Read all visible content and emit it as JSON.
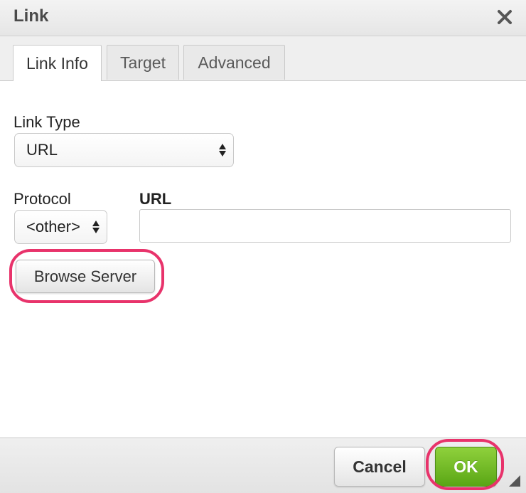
{
  "dialog": {
    "title": "Link",
    "close_icon": "close-icon"
  },
  "tabs": [
    {
      "label": "Link Info",
      "active": true
    },
    {
      "label": "Target",
      "active": false
    },
    {
      "label": "Advanced",
      "active": false
    }
  ],
  "link_info": {
    "link_type_label": "Link Type",
    "link_type_value": "URL",
    "protocol_label": "Protocol",
    "protocol_value": "<other>",
    "url_label": "URL",
    "url_value": "",
    "browse_button": "Browse Server"
  },
  "footer": {
    "cancel_label": "Cancel",
    "ok_label": "OK"
  },
  "colors": {
    "highlight": "#e8336b",
    "ok_green": "#6bb81f"
  }
}
